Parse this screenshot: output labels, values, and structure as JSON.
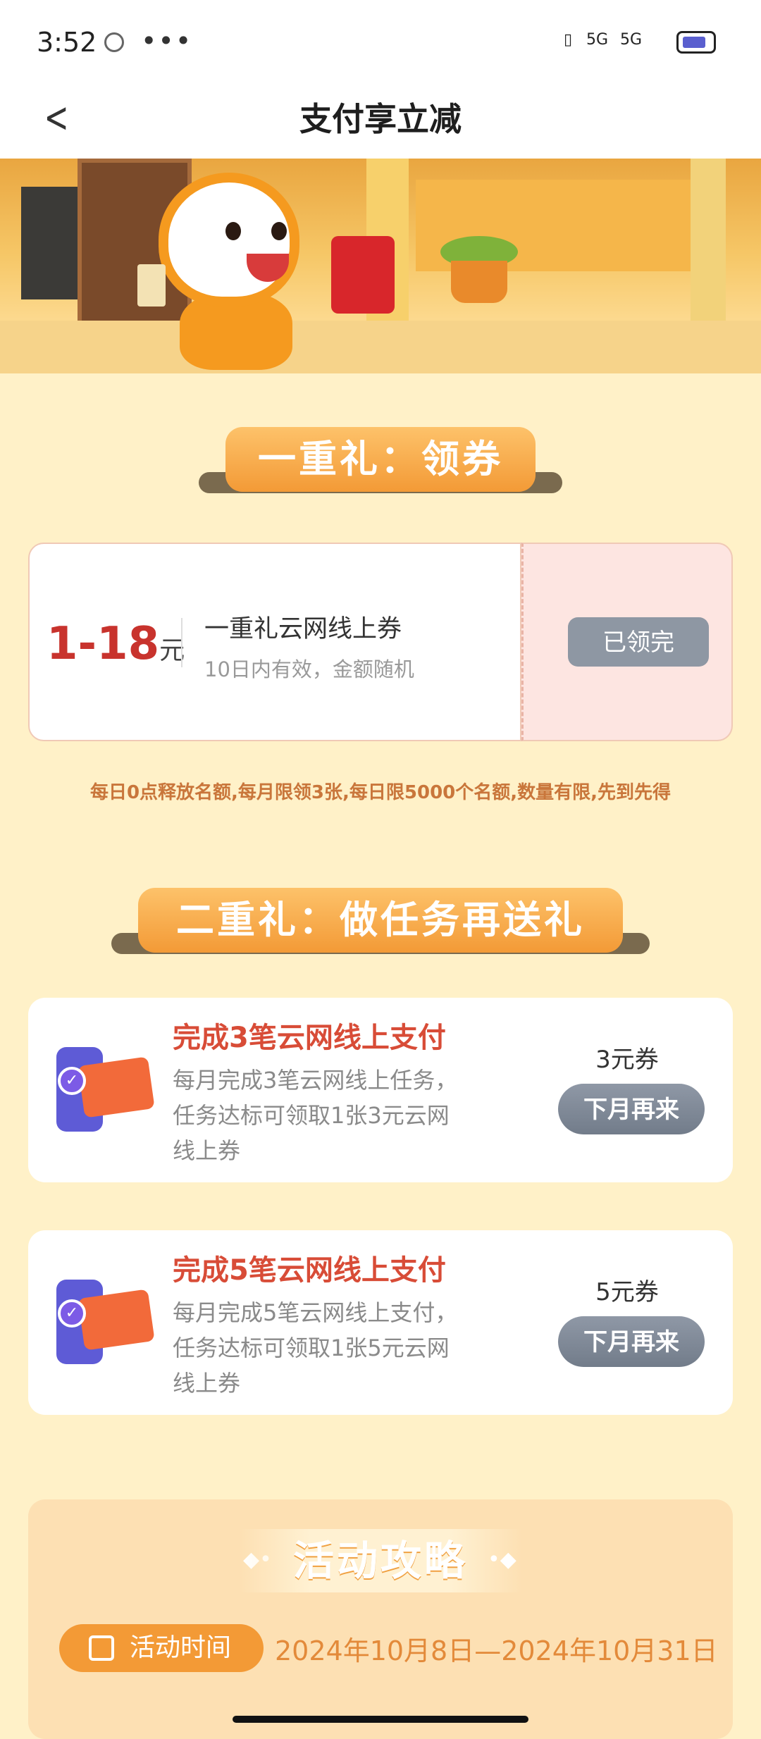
{
  "status_bar": {
    "time": "3:52",
    "more": "•••",
    "signal_1": "5G",
    "signal_2": "5G"
  },
  "header": {
    "back_icon": "chevron-left-icon",
    "title": "支付享立减"
  },
  "section1": {
    "title": "一重礼：领券",
    "coupon": {
      "amount": "1-18",
      "unit": "元",
      "name": "一重礼云网线上券",
      "desc": "10日内有效，金额随机",
      "status_button": "已领完"
    },
    "notice": "每日0点释放名额,每月限领3张,每日限5000个名额,数量有限,先到先得"
  },
  "section2": {
    "title": "二重礼：做任务再送礼",
    "tasks": [
      {
        "title": "完成3笔云网线上支付",
        "desc": "每月完成3笔云网线上任务，任务达标可领取1张3元云网线上券",
        "reward": "3元券",
        "button": "下月再来"
      },
      {
        "title": "完成5笔云网线上支付",
        "desc": "每月完成5笔云网线上支付，任务达标可领取1张5元云网线上券",
        "reward": "5元券",
        "button": "下月再来"
      }
    ]
  },
  "guide": {
    "title": "活动攻略",
    "time_label": "活动时间",
    "time_range": "2024年10月8日—2024年10月31日"
  },
  "colors": {
    "page_bg": "#FFF1C8",
    "accent_orange": "#F39A36",
    "amount_red": "#C8332D",
    "task_title_red": "#D84C37",
    "disabled_gray": "#8E97A3"
  }
}
